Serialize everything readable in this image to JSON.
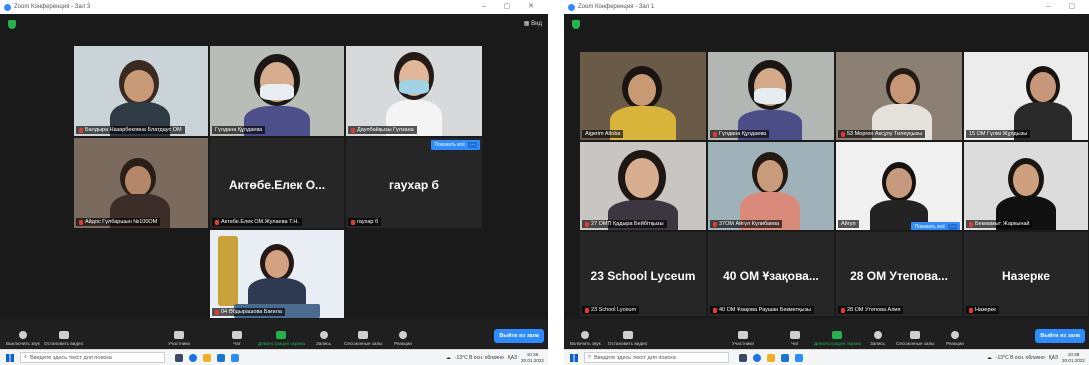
{
  "left": {
    "title": "Zoom Конференция - Зал 3",
    "view_label": "Вид",
    "tiles": [
      {
        "name": "Балдыра Назарбековна Блатдаус ОМ",
        "muted": true
      },
      {
        "name": "Гүлдана Құлдаева",
        "muted": false
      },
      {
        "name": "Даулбайқызы Гүлзана",
        "muted": true
      },
      {
        "name": "Айдос Гүлбаршын №100ОМ",
        "muted": true
      },
      {
        "name": "Актөбе.Елек ОМ.Жулаева Т.Н.",
        "muted": true,
        "big": "Актөбе.Елек О..."
      },
      {
        "name": "гаухар б",
        "muted": true,
        "big": "гаухар б"
      },
      {
        "name": "04 Әбдырашова Бағила",
        "muted": true
      }
    ],
    "pin_label": "Показать всё",
    "toolbar": {
      "mute": "Выключить звук",
      "video": "Остановить видео",
      "participants": "Участники",
      "participants_count": "7",
      "chat": "Чат",
      "share": "Демонстрация экрана",
      "record": "Запись",
      "breakout": "Сессионные залы",
      "reactions": "Реакции",
      "leave": "Выйти из зала"
    },
    "taskbar": {
      "search_placeholder": "Введите здесь текст для поиска",
      "weather": "-13°C В осн. облачно",
      "lang": "ҚАЗ",
      "time": "10:36",
      "date": "20.01.2022"
    }
  },
  "right": {
    "title": "Zoom Конференция - Зал 1",
    "tiles": [
      {
        "name": "Aigerim Altoba",
        "muted": false
      },
      {
        "name": "Гүлдана Құлдаева",
        "muted": true
      },
      {
        "name": "53 Мерген Аксұлу Тилеуқызы",
        "muted": true
      },
      {
        "name": "15 ОМ Гүлім Жұлдызы",
        "muted": false
      },
      {
        "name": "27 ОМП Қадыра Бейбітқызы",
        "muted": true
      },
      {
        "name": "37ОМ Айгүл Күлибаева",
        "muted": true
      },
      {
        "name": "Айгул",
        "muted": false
      },
      {
        "name": "Бекмамыт Жаркынай",
        "muted": true
      },
      {
        "name": "23 School Lyceum",
        "muted": true,
        "big": "23 School Lyceum"
      },
      {
        "name": "40 ОМ Ұзақова Раушан Бекметқызы",
        "muted": true,
        "big": "40 ОМ Ұзақова..."
      },
      {
        "name": "28 ОМ Утепова Алия",
        "muted": true,
        "big": "28 ОМ Утепова..."
      },
      {
        "name": "Назерке",
        "muted": true,
        "big": "Назерке"
      }
    ],
    "pin_label": "Показать всё",
    "toolbar": {
      "mute": "Включить звук",
      "video": "Остановить видео",
      "participants": "Участники",
      "participants_count": "12",
      "chat": "Чат",
      "share": "Демонстрация экрана",
      "record": "Запись",
      "breakout": "Сессионные залы",
      "reactions": "Реакции",
      "leave": "Выйти из зала"
    },
    "taskbar": {
      "search_placeholder": "Введите здесь текст для поиска",
      "weather": "-13°C В осн. облачно",
      "lang": "ҚАЗ",
      "time": "10:38",
      "date": "20.01.2022"
    }
  },
  "colors": {
    "zoom_blue": "#2d8cff",
    "active_speaker": "#d6e649",
    "share_green": "#23b24c",
    "muted_red": "#e23a3a"
  }
}
